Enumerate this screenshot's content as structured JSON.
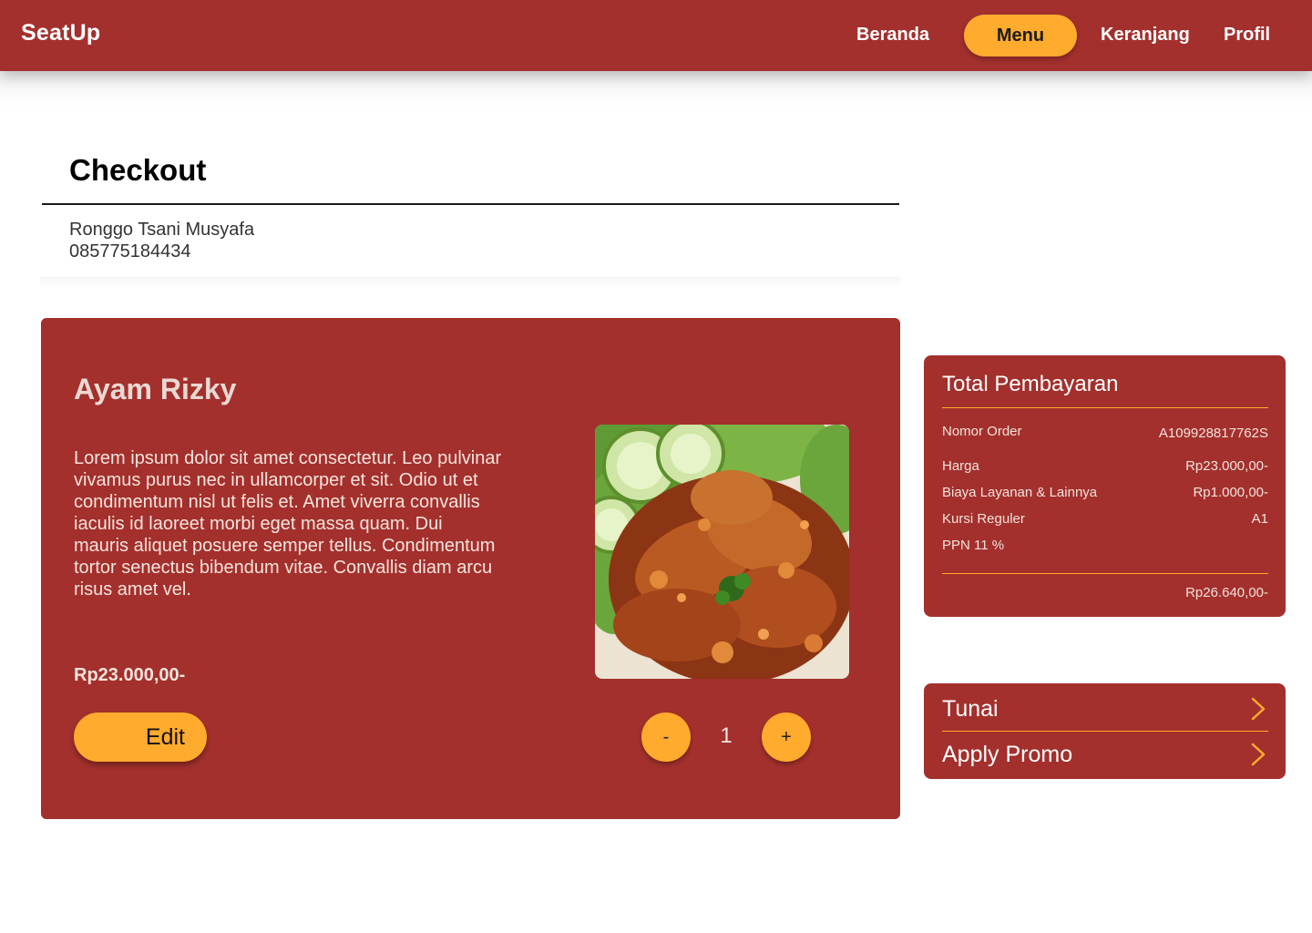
{
  "nav": {
    "brand": "SeatUp",
    "items": [
      {
        "label": "Beranda",
        "active": false
      },
      {
        "label": "Menu",
        "active": true
      },
      {
        "label": "Keranjang",
        "active": false
      },
      {
        "label": "Profil",
        "active": false
      }
    ]
  },
  "checkout": {
    "title": "Checkout",
    "customer_name": "Ronggo Tsani Musyafa",
    "customer_phone": "085775184434"
  },
  "item": {
    "name": "Ayam Rizky",
    "description": "Lorem ipsum dolor sit amet consectetur. Leo pulvinar vivamus purus nec in ullamcorper et sit. Odio ut et condimentum nisl ut felis et. Amet viverra convallis iaculis id laoreet morbi eget massa quam. Dui mauris aliquet posuere semper tellus. Condimentum tortor senectus bibendum vitae. Convallis diam arcu risus amet vel.",
    "price": "Rp23.000,00-",
    "edit_label": "Edit",
    "quantity": "1",
    "decrement_label": "-",
    "increment_label": "+",
    "image_icon": "fried-chicken-photo"
  },
  "summary": {
    "title": "Total Pembayaran",
    "rows": [
      {
        "label": "Nomor Order",
        "value": "A109928817762S"
      },
      {
        "label": "Harga",
        "value": "Rp23.000,00-"
      },
      {
        "label": "Biaya Layanan & Lainnya",
        "value": "Rp1.000,00-"
      },
      {
        "label": "Kursi Reguler",
        "value": "A1"
      },
      {
        "label": "PPN 11 %",
        "value": ""
      }
    ],
    "total": "Rp26.640,00-"
  },
  "payment": {
    "method_label": "Tunai",
    "promo_label": "Apply Promo",
    "chevron_icon": "chevron-right-icon"
  },
  "colors": {
    "primary": "#a3302d",
    "accent": "#ffab2e",
    "text_light": "#f4e4dd"
  }
}
